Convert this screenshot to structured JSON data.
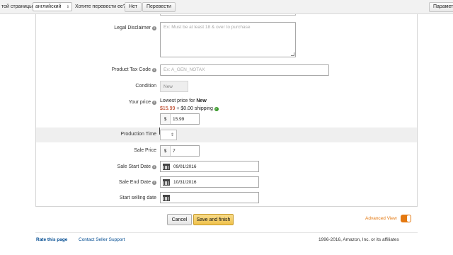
{
  "translate_bar": {
    "page_lang_prefix": "той страницы",
    "language_selected": "английский",
    "question": "Хотите перевести ее?",
    "no_button": "Нет",
    "translate_button": "Перевести",
    "options_button": "Парамет"
  },
  "form": {
    "legal_disclaimer": {
      "label": "Legal Disclaimer",
      "placeholder": "Ex: Must be at least 18 & over to purchase"
    },
    "product_tax_code": {
      "label": "Product Tax Code",
      "placeholder": "Ex: A_GEN_NOTAX"
    },
    "condition": {
      "label": "Condition",
      "value": "New"
    },
    "your_price": {
      "label": "Your price",
      "lowest_prefix": "Lowest price for",
      "lowest_condition": "New",
      "lowest_amount": "$15.99",
      "shipping": "+ $0.00 shipping",
      "currency": "$",
      "value": "15.99"
    },
    "production_time": {
      "label": "Production Time",
      "value": ""
    },
    "sale_price": {
      "label": "Sale Price",
      "currency": "$",
      "value": "7"
    },
    "sale_start_date": {
      "label": "Sale Start Date",
      "value": "09/01/2016"
    },
    "sale_end_date": {
      "label": "Sale End Date",
      "value": "10/31/2016"
    },
    "start_selling_date": {
      "label": "Start selling date",
      "value": ""
    }
  },
  "actions": {
    "cancel": "Cancel",
    "save": "Save and finish",
    "advanced_view": "Advanced View"
  },
  "footer": {
    "rate": "Rate this page",
    "contact": "Contact Seller Support",
    "copyright": "1996-2016, Amazon, Inc. or its affiliates"
  },
  "colors": {
    "accent_orange": "#e47911",
    "price_red": "#b12704",
    "link_blue": "#004b91",
    "save_button": "#f0c14b"
  }
}
